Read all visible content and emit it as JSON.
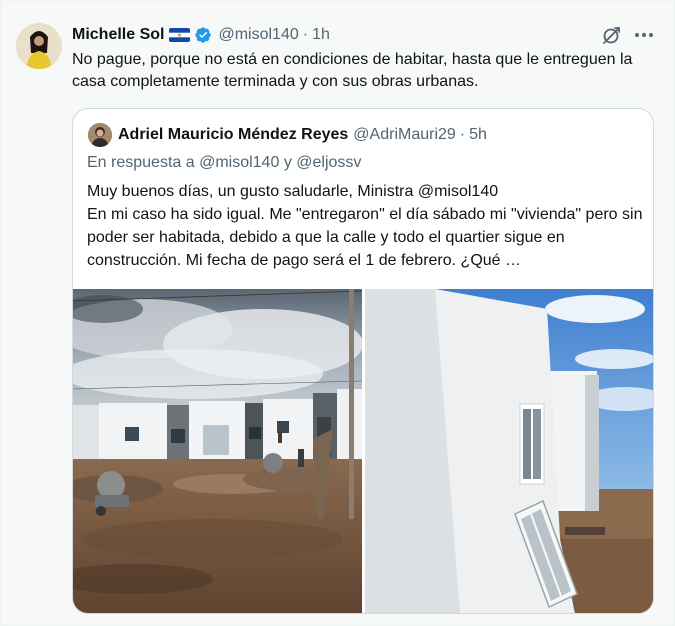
{
  "tweet": {
    "author_name": "Michelle Sol",
    "handle": "@misol140",
    "separator": "·",
    "time": "1h",
    "text": "No pague, porque no está en condiciones de habitar, hasta que le entreguen la casa completamente terminada y con sus obras urbanas."
  },
  "quoted": {
    "author_name": "Adriel Mauricio Méndez Reyes",
    "handle": "@AdriMauri29",
    "separator": "·",
    "time": "5h",
    "reply_prefix": "En respuesta a",
    "reply_to_1": "@misol140",
    "reply_joiner": "y",
    "reply_to_2": "@eljossv",
    "text_line_1": "Muy buenos días, un gusto saludarle, Ministra @misol140",
    "text_line_2": "En mi caso ha sido igual. Me \"entregaron\" el día sábado mi \"vivienda\" pero sin poder ser habitada, debido a que la calle y todo el quartier sigue en construcción. Mi fecha de pago será el 1 de febrero. ¿Qué …"
  },
  "icons": {
    "flag": "el-salvador-flag-icon",
    "verified": "verified-badge-icon",
    "grok": "grok-icon",
    "more": "more-options-icon"
  },
  "colors": {
    "verified_blue": "#1d9bf0",
    "secondary_text": "#536471",
    "border": "#cfd9de"
  }
}
